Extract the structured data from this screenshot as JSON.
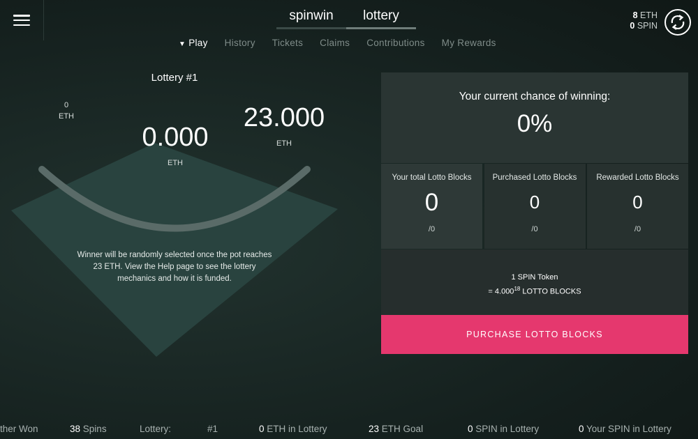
{
  "header": {
    "brand_tabs": [
      "spinwin",
      "lottery"
    ],
    "active_brand_tab": "lottery",
    "eth_balance": "8",
    "eth_unit": "ETH",
    "spin_balance": "0",
    "spin_unit": "SPIN"
  },
  "subnav": {
    "items": [
      "Play",
      "History",
      "Tickets",
      "Claims",
      "Contributions",
      "My Rewards"
    ],
    "active": "Play"
  },
  "lottery": {
    "title": "Lottery #1",
    "min_value": "0",
    "min_unit": "ETH",
    "current_value": "0.000",
    "current_unit": "ETH",
    "goal_value": "23.000",
    "goal_unit": "ETH",
    "progress_fraction": 0,
    "info_line1": "Winner will be randomly selected once the pot reaches",
    "info_line2": "23 ETH. View the Help page to see the lottery",
    "info_line3": "mechanics and how it is funded."
  },
  "panel": {
    "chance_label": "Your current chance of winning:",
    "chance_value": "0%",
    "blocks": [
      {
        "label": "Your total Lotto Blocks",
        "value": "0",
        "sub": "/0"
      },
      {
        "label": "Purchased Lotto Blocks",
        "value": "0",
        "sub": "/0"
      },
      {
        "label": "Rewarded Lotto Blocks",
        "value": "0",
        "sub": "/0"
      }
    ],
    "rate_line1": "1 SPIN Token",
    "rate_line2_prefix": "= 4.000",
    "rate_line2_sup": "18",
    "rate_line2_suffix": " LOTTO BLOCKS",
    "purchase_label": "PURCHASE LOTTO BLOCKS"
  },
  "footer": {
    "other_won": "ther Won",
    "spins_count": "38",
    "spins_label": "Spins",
    "lottery_label": "Lottery:",
    "lottery_number": "#1",
    "eth_in_lottery_value": "0",
    "eth_in_lottery_label": "ETH in Lottery",
    "eth_goal_value": "23",
    "eth_goal_label": "ETH Goal",
    "spin_in_lottery_value": "0",
    "spin_in_lottery_label": "SPIN in Lottery",
    "your_spin_value": "0",
    "your_spin_label": "Your SPIN in Lottery"
  },
  "colors": {
    "accent": "#e5386e",
    "background": "#1b2926",
    "panel": "#2a3533"
  }
}
